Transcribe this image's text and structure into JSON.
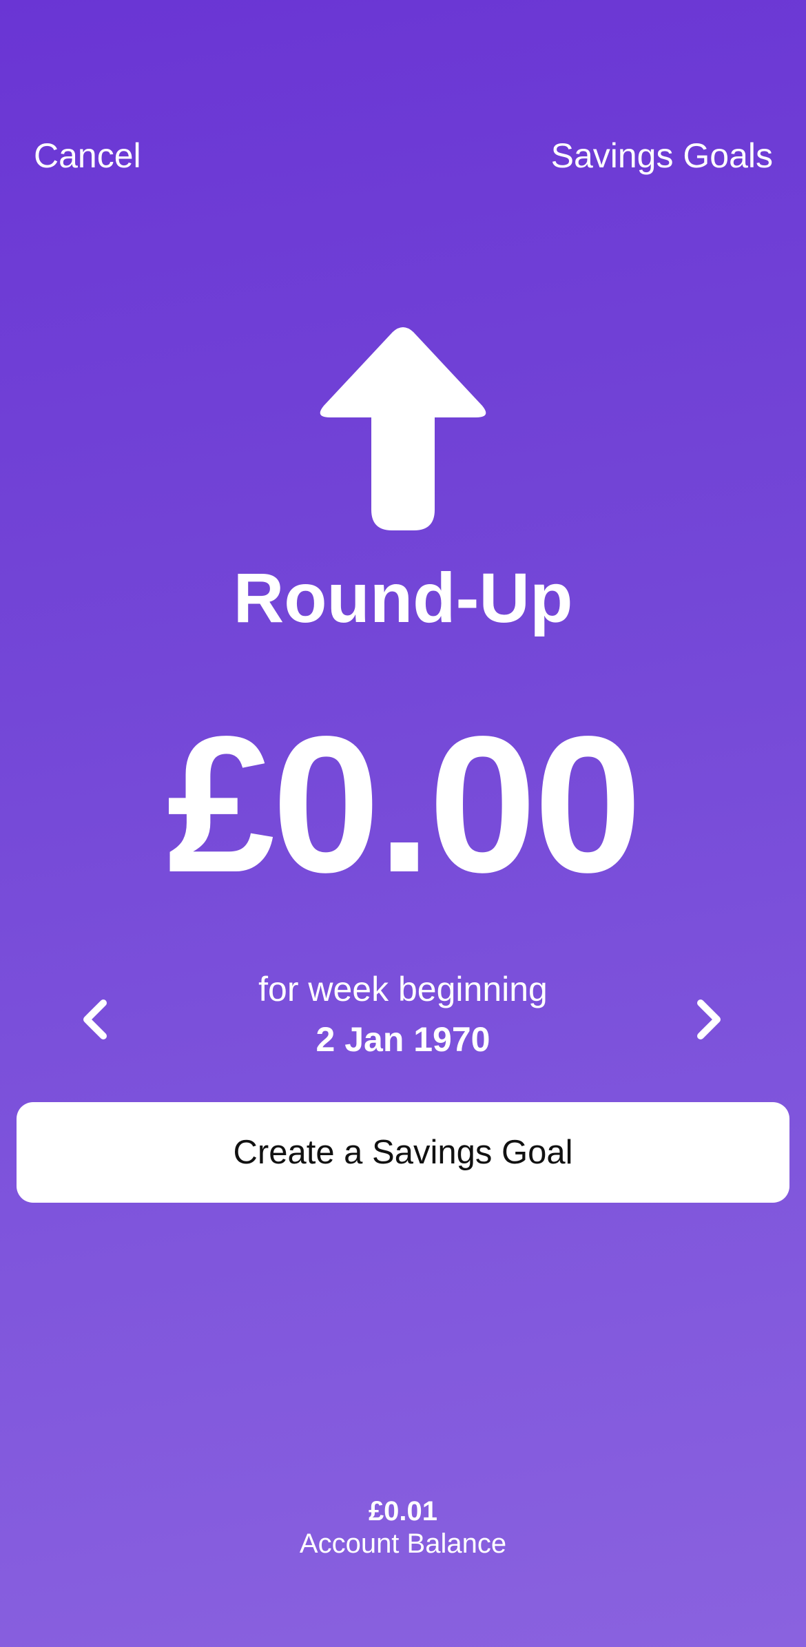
{
  "nav": {
    "cancel_label": "Cancel",
    "savings_goals_label": "Savings Goals"
  },
  "hero": {
    "icon": "arrow-up-icon",
    "title": "Round-Up",
    "amount": "£0.00"
  },
  "week": {
    "label": "for week beginning",
    "date": "2 Jan 1970",
    "prev_icon": "chevron-left-icon",
    "next_icon": "chevron-right-icon"
  },
  "actions": {
    "create_goal_label": "Create a Savings Goal"
  },
  "footer": {
    "balance_value": "£0.01",
    "balance_label": "Account Balance"
  },
  "colors": {
    "gradient_top": "#6a35d4",
    "gradient_bottom": "#8a62df",
    "text": "#ffffff",
    "button_bg": "#ffffff",
    "button_text": "#111111"
  }
}
